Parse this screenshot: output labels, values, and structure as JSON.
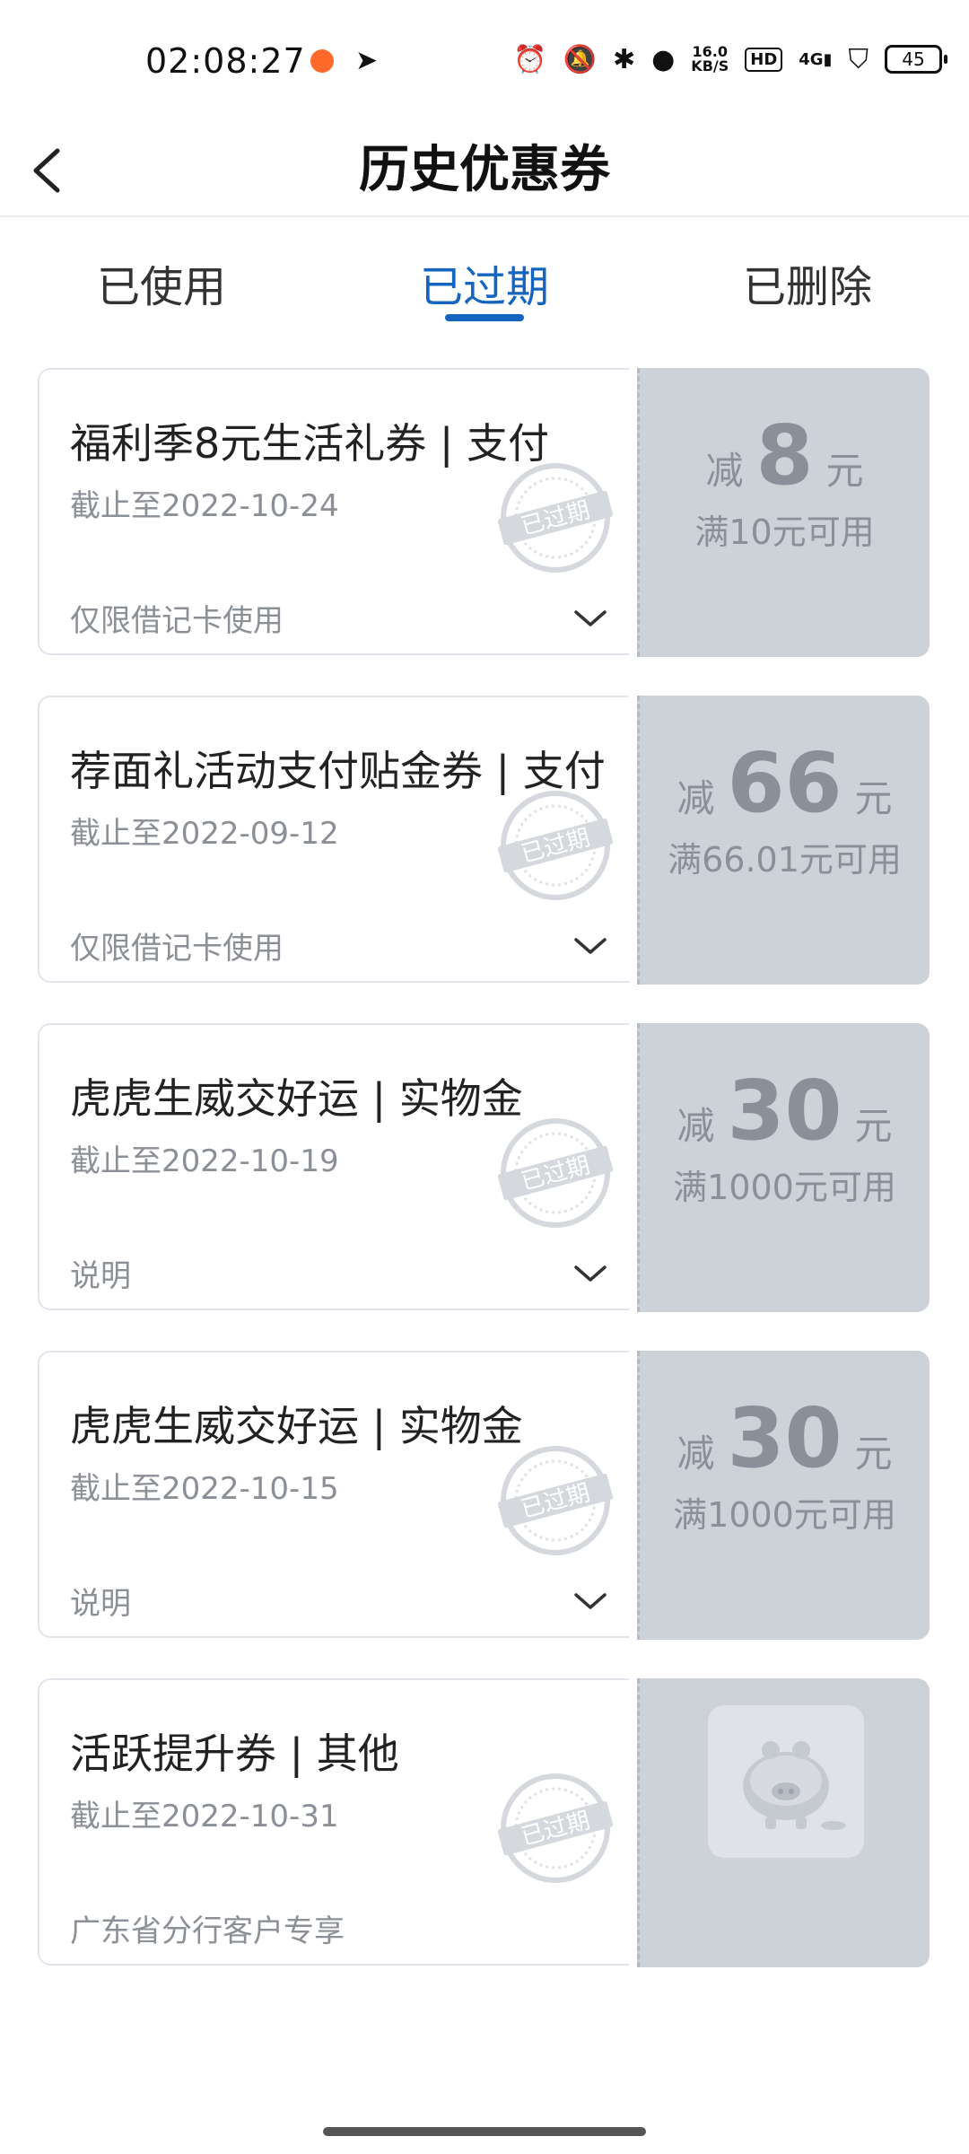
{
  "status_bar": {
    "time": "02:08:27",
    "net_speed_value": "16.0",
    "net_speed_unit": "KB/S",
    "hd": "HD",
    "network": "4G",
    "battery": "45"
  },
  "header": {
    "title": "历史优惠券"
  },
  "tabs": [
    {
      "label": "已使用",
      "active": false
    },
    {
      "label": "已过期",
      "active": true
    },
    {
      "label": "已删除",
      "active": false
    }
  ],
  "stamp_text": "已过期",
  "coupons": [
    {
      "title": "福利季8元生活礼券 | 支付",
      "date": "截止至2022-10-24",
      "note": "仅限借记卡使用",
      "amount_prefix": "减",
      "amount": "8",
      "amount_unit": "元",
      "condition": "满10元可用"
    },
    {
      "title": "荐面礼活动支付贴金券 | 支付",
      "date": "截止至2022-09-12",
      "note": "仅限借记卡使用",
      "amount_prefix": "减",
      "amount": "66",
      "amount_unit": "元",
      "condition": "满66.01元可用"
    },
    {
      "title": "虎虎生威交好运 | 实物金",
      "date": "截止至2022-10-19",
      "note": "说明",
      "amount_prefix": "减",
      "amount": "30",
      "amount_unit": "元",
      "condition": "满1000元可用"
    },
    {
      "title": "虎虎生威交好运 | 实物金",
      "date": "截止至2022-10-15",
      "note": "说明",
      "amount_prefix": "减",
      "amount": "30",
      "amount_unit": "元",
      "condition": "满1000元可用"
    },
    {
      "title": "活跃提升券 | 其他",
      "date": "截止至2022-10-31",
      "note": "广东省分行客户专享",
      "image": "piggy-bank-icon"
    }
  ],
  "colors": {
    "accent": "#1565c0",
    "coupon_right_bg": "#cdd1d8",
    "muted_text": "#8a9099"
  }
}
